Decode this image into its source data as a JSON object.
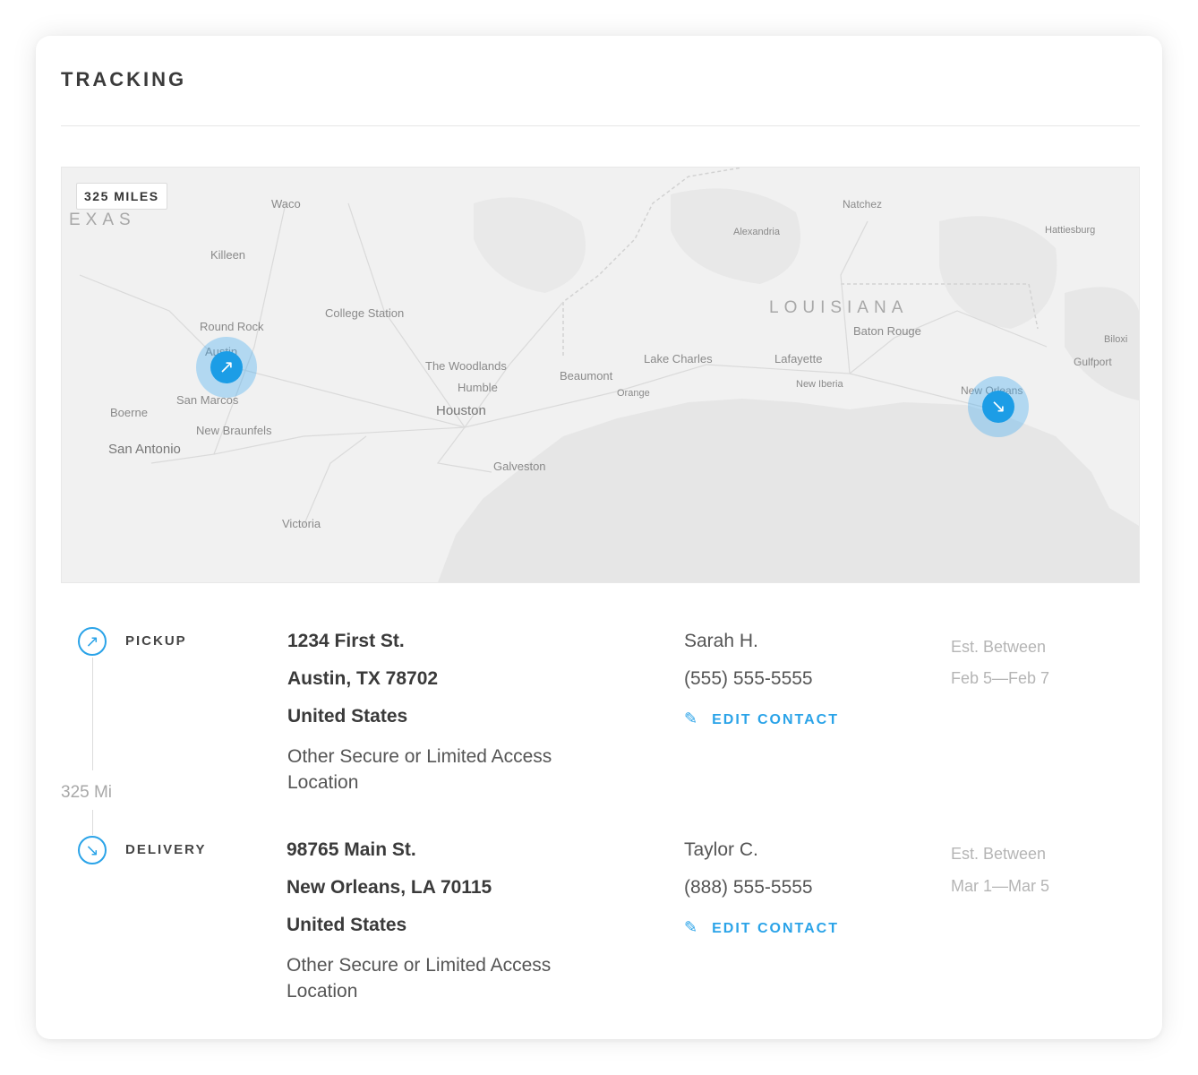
{
  "header": {
    "title": "TRACKING"
  },
  "map": {
    "distance_badge": "325 MILES",
    "labels": {
      "texas": "EXAS",
      "louisiana": "LOUISIANA",
      "waco": "Waco",
      "killeen": "Killeen",
      "round_rock": "Round Rock",
      "austin": "Austin",
      "san_marcos": "San Marcos",
      "new_braunfels": "New Braunfels",
      "boerne": "Boerne",
      "san_antonio": "San Antonio",
      "victoria": "Victoria",
      "college_station": "College Station",
      "the_woodlands": "The Woodlands",
      "humble": "Humble",
      "houston": "Houston",
      "galveston": "Galveston",
      "beaumont": "Beaumont",
      "orange": "Orange",
      "lake_charles": "Lake Charles",
      "lafayette": "Lafayette",
      "new_iberia": "New Iberia",
      "baton_rouge": "Baton Rouge",
      "new_orleans": "New Orleans",
      "alexandria": "Alexandria",
      "natchez": "Natchez",
      "hattiesburg": "Hattiesburg",
      "biloxi": "Biloxi",
      "gulfport": "Gulfport"
    },
    "pickup_pin_icon": "arrow-up-right-icon",
    "delivery_pin_icon": "arrow-down-right-icon",
    "pin_color": "#1c9de6"
  },
  "route": {
    "distance": "325 Mi"
  },
  "pickup": {
    "label": "PICKUP",
    "address_line1": "1234 First St.",
    "address_line2": "Austin, TX 78702",
    "country": "United States",
    "access_type": "Other Secure or Limited Access Location",
    "contact_name": "Sarah H.",
    "contact_phone": "(555) 555-5555",
    "edit_label": "EDIT CONTACT",
    "est_label": "Est. Between",
    "est_dates": "Feb 5—Feb 7"
  },
  "delivery": {
    "label": "DELIVERY",
    "address_line1": "98765 Main St.",
    "address_line2": "New Orleans, LA 70115",
    "country": "United States",
    "access_type": "Other Secure or Limited Access Location",
    "contact_name": "Taylor C.",
    "contact_phone": "(888) 555-5555",
    "edit_label": "EDIT CONTACT",
    "est_label": "Est. Between",
    "est_dates": "Mar 1—Mar 5"
  },
  "colors": {
    "accent": "#2aa3e8",
    "text": "#333333",
    "muted": "#b5b5b5"
  }
}
